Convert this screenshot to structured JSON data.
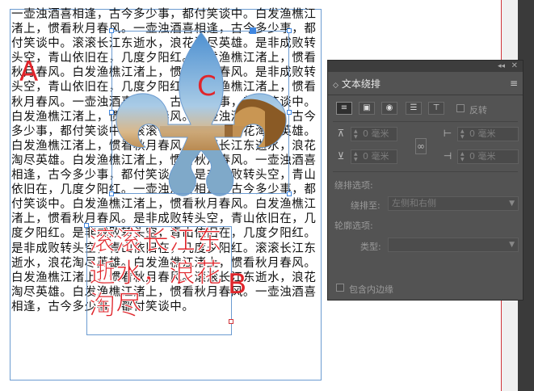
{
  "document": {
    "body_text": "一壶浊酒喜相逢，古今多少事，都付笑谈中。白发渔樵江渚上，惯看秋月春风。一壶浊酒喜相逢，古今多少事，都付笑谈中。滚滚长江东逝水，浪花淘尽英雄。是非成败转头空，青山依旧在，几度夕阳红。白发渔樵江渚上，惯看秋月春风。白发渔樵江渚上，惯看秋月春风。是非成败转头空，青山依旧在，几度夕阳红。白发渔樵江渚上，惯看秋月春风。一壶浊酒喜相逢，古今多少事，都付笑谈中。白发渔樵江渚上，惯看秋月春风。一壶浊酒喜相逢，古今多少事，都付笑谈中。滚滚长江东逝水，浪花淘尽英雄。白发渔樵江渚上，惯看秋月春风。滚滚长江东逝水，浪花淘尽英雄。白发渔樵江渚上，惯看秋月春风。一壶浊酒喜相逢，古今多少事，都付笑谈中。是非成败转头空，青山依旧在，几度夕阳红。一壶浊酒喜相逢，古今多少事，都付笑谈中。白发渔樵江渚上，惯看秋月春风。白发渔樵江渚上，惯看秋月春风。是非成败转头空，青山依旧在，几度夕阳红。是非成败转头空，青山依旧在，几度夕阳红。是非成败转头空，青山依旧在，几度夕阳红。滚滚长江东逝水，浪花淘尽英雄。白发渔樵江渚上，惯看秋月春风。白发渔樵江渚上，惯看秋月春风。滚滚长江东逝水，浪花淘尽英雄。白发渔樵江渚上，惯看秋月春风。一壶浊酒喜相逢，古今多少事，都付笑谈中。",
    "path_text": "滚滚长江东逝水，浪花淘尽",
    "label_a": "A",
    "label_b": "B",
    "label_c": "C"
  },
  "panel": {
    "title": "文本绕排",
    "invert_label": "反转",
    "top_offset": "0 毫米",
    "bottom_offset": "0 毫米",
    "left_offset": "0 毫米",
    "right_offset": "0 毫米",
    "wrap_options_header": "绕排选项:",
    "wrap_to_label": "绕排至:",
    "wrap_to_value": "左侧和右侧",
    "contour_options_header": "轮廓选项:",
    "type_label": "类型:",
    "type_value": "",
    "include_inside_edges": "包含内边缘"
  },
  "colors": {
    "label_red": "#e0252b",
    "frame_blue": "#6b9bd1",
    "panel_bg": "#535353"
  },
  "icons": [
    "wrap-none-icon",
    "wrap-bounding-box-icon",
    "wrap-object-shape-icon",
    "jump-object-icon",
    "jump-next-column-icon",
    "link-chain-icon",
    "menu-icon"
  ]
}
